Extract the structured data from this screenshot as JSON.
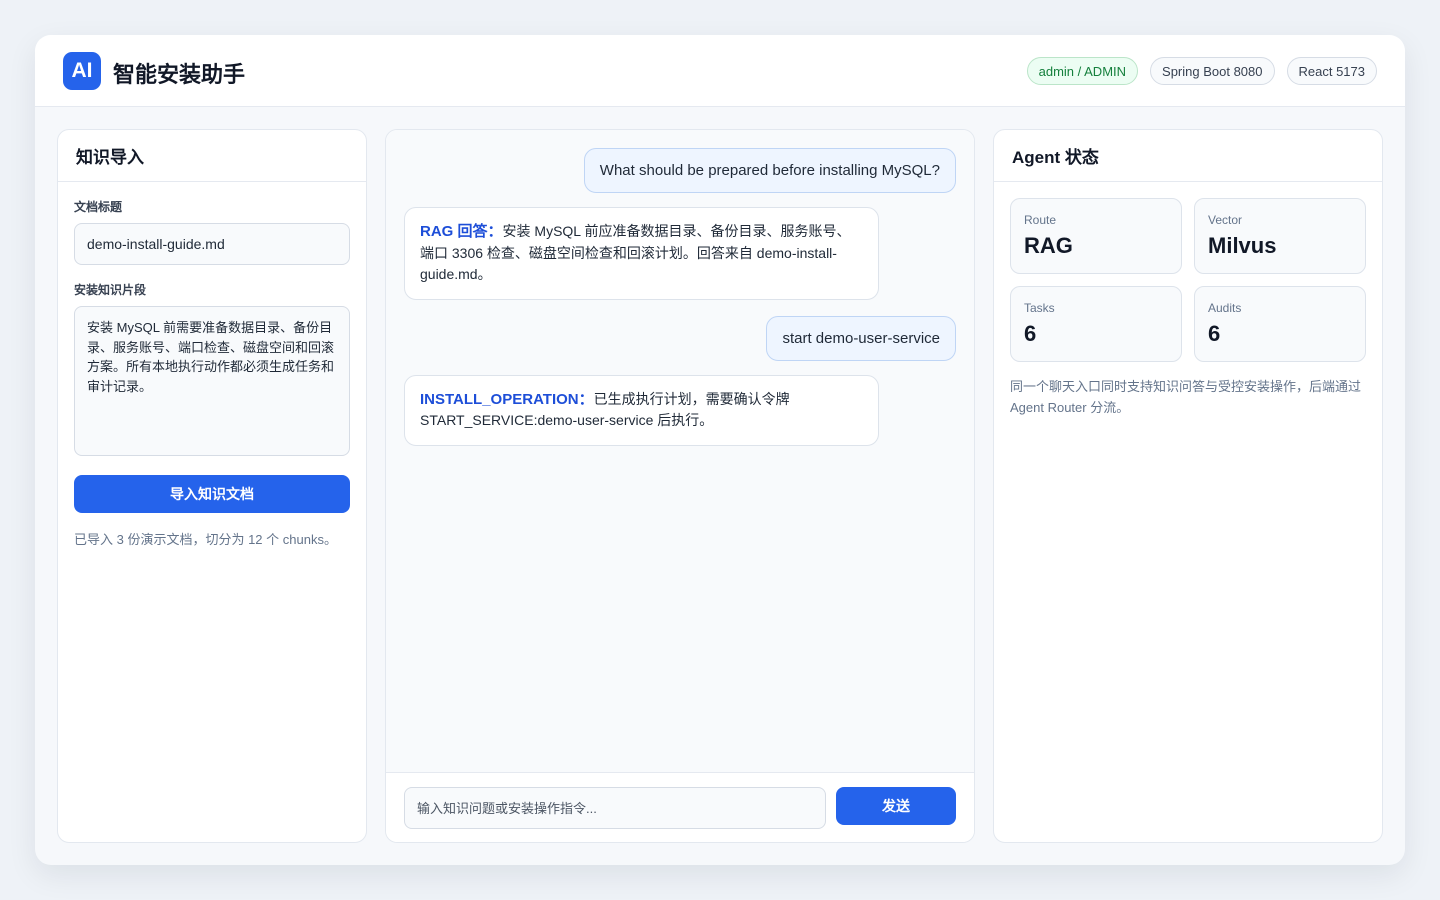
{
  "header": {
    "logo_text": "AI",
    "title": "智能安装助手",
    "badges": [
      {
        "label": "admin / ADMIN",
        "variant": "green"
      },
      {
        "label": "Spring Boot 8080",
        "variant": "default"
      },
      {
        "label": "React 5173",
        "variant": "default"
      }
    ]
  },
  "knowledge": {
    "title": "知识导入",
    "doc_title_label": "文档标题",
    "doc_title_value": "demo-install-guide.md",
    "snippet_label": "安装知识片段",
    "snippet_value": "安装 MySQL 前需要准备数据目录、备份目录、服务账号、端口检查、磁盘空间和回滚方案。所有本地执行动作都必须生成任务和审计记录。",
    "import_button": "导入知识文档",
    "status_text": "已导入 3 份演示文档，切分为 12 个 chunks。"
  },
  "chat": {
    "messages": [
      {
        "role": "user",
        "text": "What should be prepared before installing MySQL?"
      },
      {
        "role": "bot",
        "tag": "RAG 回答：",
        "text": "安装 MySQL 前应准备数据目录、备份目录、服务账号、端口 3306 检查、磁盘空间检查和回滚计划。回答来自 demo-install-guide.md。"
      },
      {
        "role": "user",
        "text": "start demo-user-service"
      },
      {
        "role": "bot",
        "tag": "INSTALL_OPERATION：",
        "text": "已生成执行计划，需要确认令牌 START_SERVICE:demo-user-service 后执行。"
      }
    ],
    "input_placeholder": "输入知识问题或安装操作指令...",
    "send_button": "发送"
  },
  "agent": {
    "title": "Agent 状态",
    "stats": [
      {
        "label": "Route",
        "value": "RAG"
      },
      {
        "label": "Vector",
        "value": "Milvus"
      },
      {
        "label": "Tasks",
        "value": "6"
      },
      {
        "label": "Audits",
        "value": "6"
      }
    ],
    "note": "同一个聊天入口同时支持知识问答与受控安装操作，后端通过 Agent Router 分流。"
  },
  "colors": {
    "accent": "#2563eb",
    "success": "#15803d"
  }
}
